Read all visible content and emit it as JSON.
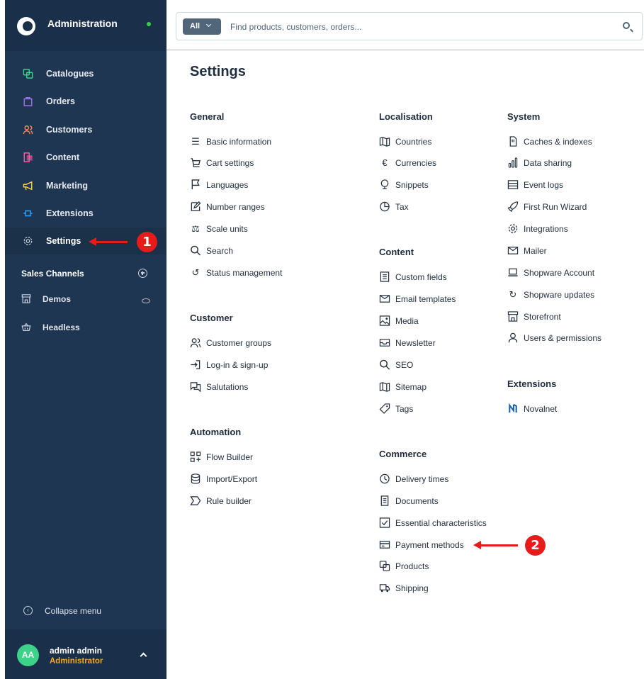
{
  "sidebar": {
    "title": "Administration",
    "status_color": "#37d046",
    "nav": [
      {
        "label": "Catalogues",
        "icon": "catalogue-icon",
        "color": "#3dd28a"
      },
      {
        "label": "Orders",
        "icon": "orders-icon",
        "color": "#a070e6"
      },
      {
        "label": "Customers",
        "icon": "customers-icon",
        "color": "#ff8a4c"
      },
      {
        "label": "Content",
        "icon": "content-icon",
        "color": "#ff5aa0"
      },
      {
        "label": "Marketing",
        "icon": "marketing-icon",
        "color": "#ffd23f"
      },
      {
        "label": "Extensions",
        "icon": "extensions-icon",
        "color": "#2ea5ff"
      },
      {
        "label": "Settings",
        "icon": "settings-icon",
        "color": "#c9d2dd"
      }
    ],
    "sales_channels_heading": "Sales Channels",
    "sales_channels": [
      {
        "label": "Demos",
        "icon": "storefront-icon"
      },
      {
        "label": "Headless",
        "icon": "basket-icon"
      }
    ],
    "collapse_label": "Collapse menu",
    "user": {
      "initials": "AA",
      "name": "admin admin",
      "role": "Administrator"
    }
  },
  "search": {
    "filter_label": "All",
    "placeholder": "Find products, customers, orders..."
  },
  "page_title": "Settings",
  "columns": {
    "general": {
      "heading": "General",
      "items": [
        "Basic information",
        "Cart settings",
        "Languages",
        "Number ranges",
        "Scale units",
        "Search",
        "Status management"
      ]
    },
    "customer": {
      "heading": "Customer",
      "items": [
        "Customer groups",
        "Log-in & sign-up",
        "Salutations"
      ]
    },
    "automation": {
      "heading": "Automation",
      "items": [
        "Flow Builder",
        "Import/Export",
        "Rule builder"
      ]
    },
    "localisation": {
      "heading": "Localisation",
      "items": [
        "Countries",
        "Currencies",
        "Snippets",
        "Tax"
      ]
    },
    "content": {
      "heading": "Content",
      "items": [
        "Custom fields",
        "Email templates",
        "Media",
        "Newsletter",
        "SEO",
        "Sitemap",
        "Tags"
      ]
    },
    "commerce": {
      "heading": "Commerce",
      "items": [
        "Delivery times",
        "Documents",
        "Essential characteristics",
        "Payment methods",
        "Products",
        "Shipping"
      ]
    },
    "system": {
      "heading": "System",
      "items": [
        "Caches & indexes",
        "Data sharing",
        "Event logs",
        "First Run Wizard",
        "Integrations",
        "Mailer",
        "Shopware Account",
        "Shopware updates",
        "Storefront",
        "Users & permissions"
      ]
    },
    "extensions": {
      "heading": "Extensions",
      "items": [
        "Novalnet"
      ]
    }
  },
  "annotations": {
    "badge_1": "1",
    "badge_2": "2",
    "color": "#e81a1a"
  }
}
